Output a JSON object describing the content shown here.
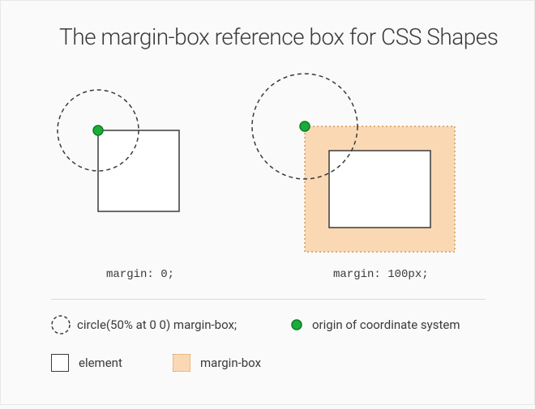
{
  "title": "The margin-box reference box for CSS Shapes",
  "examples": {
    "left": {
      "caption": "margin: 0;"
    },
    "right": {
      "caption": "margin: 100px;"
    }
  },
  "legend": {
    "circle": "circle(50% at 0 0) margin-box;",
    "origin": "origin of coordinate system",
    "element": "element",
    "marginbox": "margin-box"
  },
  "colors": {
    "peach": "#fbd8b4",
    "peach_border": "#d49a5a",
    "green": "#1aad3a",
    "green_stroke": "#0c7a24",
    "stroke": "#3a3a3a"
  }
}
